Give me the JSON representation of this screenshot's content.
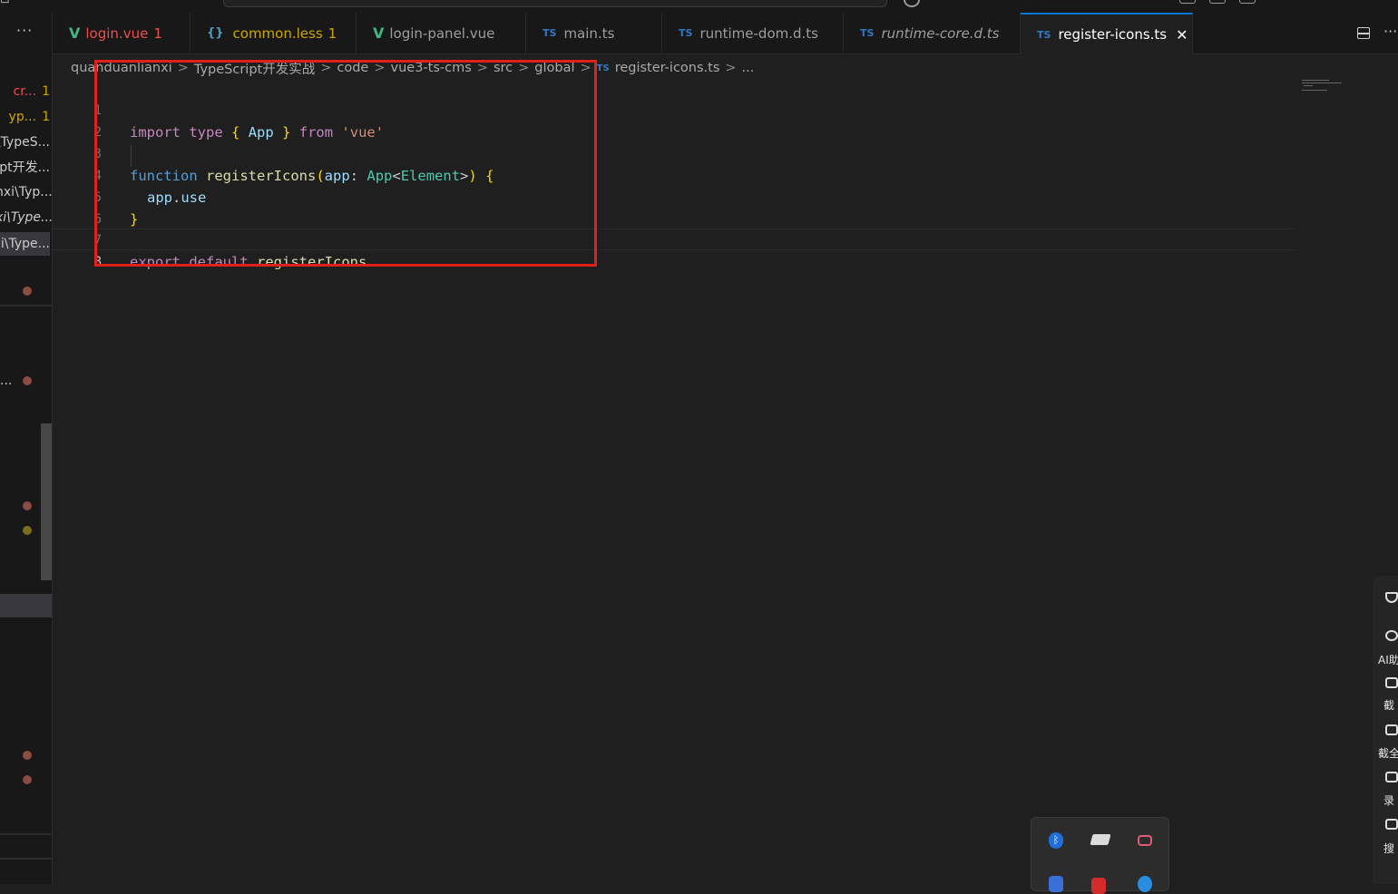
{
  "sidebar": {
    "more_label": "···",
    "rows": [
      {
        "label": "cr...",
        "badge": "1"
      },
      {
        "label": "yp...",
        "badge": "1"
      },
      {
        "label": "\\TypeS..."
      },
      {
        "label": "pt开发..."
      },
      {
        "label": "nxi\\Typ..."
      },
      {
        "label": "xi\\Type..."
      },
      {
        "label": "i\\Type..."
      },
      {
        "label": "..."
      }
    ]
  },
  "tabs": [
    {
      "label": "login.vue",
      "badge": "1",
      "icon": "vue-icon"
    },
    {
      "label": "common.less",
      "badge": "1",
      "icon": "braces-icon"
    },
    {
      "label": "login-panel.vue",
      "icon": "vue-icon"
    },
    {
      "label": "main.ts",
      "icon": "ts-icon"
    },
    {
      "label": "runtime-dom.d.ts",
      "icon": "ts-icon"
    },
    {
      "label": "runtime-core.d.ts",
      "icon": "ts-icon"
    },
    {
      "label": "register-icons.ts",
      "icon": "ts-icon",
      "active": true,
      "close": "✕"
    }
  ],
  "tab_more": "···",
  "icons": {
    "vue": "V",
    "less": "{}",
    "ts": "TS"
  },
  "breadcrumb": [
    "quanduanlianxi",
    "TypeScript开发实战",
    "code",
    "vue3-ts-cms",
    "src",
    "global",
    "register-icons.ts",
    "..."
  ],
  "breadcrumb_sep": ">",
  "editor": {
    "line_numbers": [
      "1",
      "2",
      "3",
      "4",
      "5",
      "6",
      "7",
      "8"
    ],
    "current_line": 8,
    "code": {
      "l1": {
        "import": "import",
        "type": "type",
        "brace_open": "{",
        "App": "App",
        "brace_close": "}",
        "from": "from",
        "module": "'vue'"
      },
      "l3": {
        "function": "function",
        "name": "registerIcons",
        "paren_open": "(",
        "param": "app",
        "colon": ":",
        "type": "App",
        "generic_open": "<",
        "generic_type": "Element",
        "generic_close": ">",
        "paren_close": ")",
        "brace": "{"
      },
      "l4": {
        "obj": "app",
        "dot": ".",
        "prop": "use"
      },
      "l5": {
        "brace": "}"
      },
      "l7": {
        "export": "export",
        "default": "default",
        "name": "registerIcons"
      }
    }
  },
  "float_bar": {
    "labels": [
      "AI助",
      "截",
      "截全",
      "录",
      "搜"
    ]
  },
  "colors": {
    "keyword": "#c586c0",
    "storage": "#569cd6",
    "variable": "#9cdcfe",
    "function": "#dcdcaa",
    "type": "#4ec9b0",
    "string": "#ce9178",
    "highlight_box": "#e0201b",
    "active_tab_border": "#0078d4"
  }
}
